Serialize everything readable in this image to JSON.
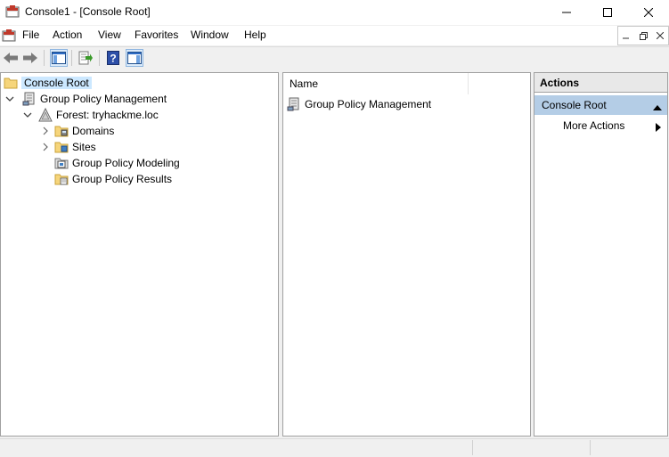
{
  "window": {
    "title": "Console1 - [Console Root]"
  },
  "menu": {
    "items": [
      "File",
      "Action",
      "View",
      "Favorites",
      "Window",
      "Help"
    ]
  },
  "tree": {
    "root": "Console Root",
    "gpm": "Group Policy Management",
    "forest": "Forest: tryhackme.loc",
    "domains": "Domains",
    "sites": "Sites",
    "modeling": "Group Policy Modeling",
    "results": "Group Policy Results"
  },
  "list": {
    "column_name": "Name",
    "rows": [
      "Group Policy Management"
    ]
  },
  "actions": {
    "title": "Actions",
    "section": "Console Root",
    "items": [
      "More Actions"
    ]
  },
  "colors": {
    "selection": "#cce8ff",
    "actions_section": "#b4cde6"
  }
}
